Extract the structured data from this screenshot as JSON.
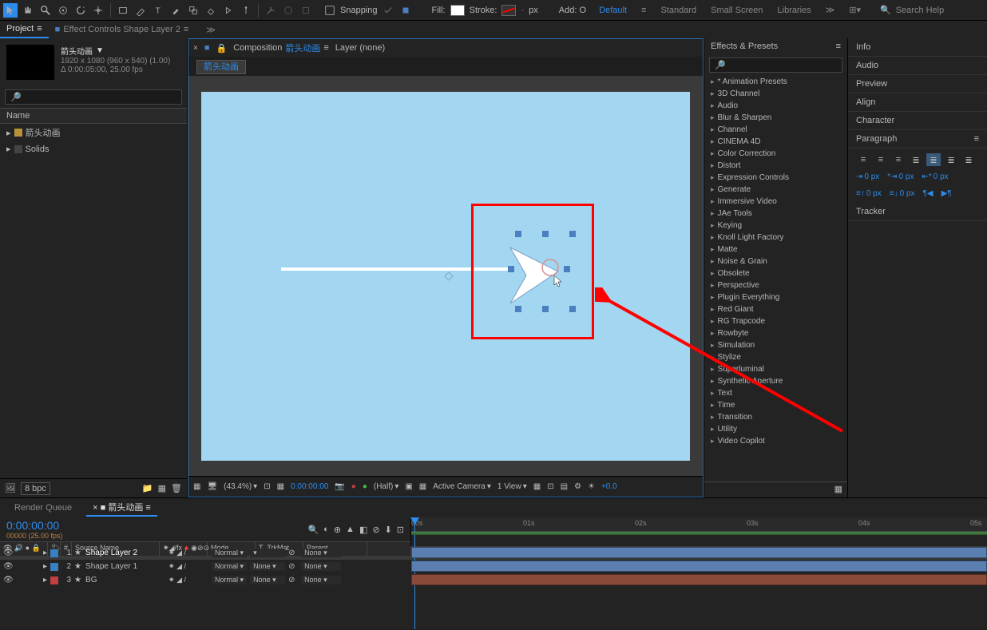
{
  "toolbar": {
    "snapping_label": "Snapping",
    "fill_label": "Fill:",
    "stroke_label": "Stroke:",
    "stroke_px": "px",
    "add_label": "Add: O"
  },
  "workspaces": {
    "default": "Default",
    "standard": "Standard",
    "small_screen": "Small Screen",
    "libraries": "Libraries"
  },
  "search": {
    "placeholder": "Search Help"
  },
  "project": {
    "tab_project": "Project",
    "tab_effect_controls": "Effect Controls Shape Layer 2",
    "comp_name": "箭头动画",
    "comp_dims": "1920 x 1080  (960 x 540) (1.00)",
    "comp_dur": "Δ 0:00:05:00, 25.00 fps",
    "col_name": "Name",
    "items": [
      {
        "name": "箭头动画",
        "color": "#b8923a"
      },
      {
        "name": "Solids",
        "color": "#444444"
      }
    ],
    "bpc": "8 bpc"
  },
  "comp_panel": {
    "tab_comp_prefix": "Composition",
    "tab_comp_name": "箭头动画",
    "tab_layer": "Layer (none)",
    "breadcrumb": "箭头动画",
    "lock_icon": "lock-icon"
  },
  "viewer_footer": {
    "zoom": "(43.4%)",
    "timecode": "0:00:00:00",
    "quality": "(Half)",
    "camera": "Active Camera",
    "view": "1 View",
    "exposure": "+0.0"
  },
  "effects": {
    "title": "Effects & Presets",
    "categories": [
      "* Animation Presets",
      "3D Channel",
      "Audio",
      "Blur & Sharpen",
      "Channel",
      "CINEMA 4D",
      "Color Correction",
      "Distort",
      "Expression Controls",
      "Generate",
      "Immersive Video",
      "JAe Tools",
      "Keying",
      "Knoll Light Factory",
      "Matte",
      "Noise & Grain",
      "Obsolete",
      "Perspective",
      "Plugin Everything",
      "Red Giant",
      "RG Trapcode",
      "Rowbyte",
      "Simulation",
      "Stylize",
      "Superluminal",
      "Synthetic Aperture",
      "Text",
      "Time",
      "Transition",
      "Utility",
      "Video Copilot"
    ]
  },
  "right_panels": {
    "sections": [
      "Info",
      "Audio",
      "Preview",
      "Align",
      "Character"
    ],
    "paragraph": "Paragraph",
    "tracker": "Tracker",
    "indent_val": "0 px"
  },
  "timeline": {
    "tab_render": "Render Queue",
    "tab_comp": "箭头动画",
    "timecode": "0:00:00:00",
    "framerate": "00000 (25.00 fps)",
    "cols": {
      "num": "#",
      "source": "Source Name",
      "mode": "Mode",
      "trkmat": "T .TrkMat",
      "parent": "Parent"
    },
    "ruler": [
      "00s",
      "01s",
      "02s",
      "03s",
      "04s",
      "05s"
    ],
    "layers": [
      {
        "num": "1",
        "name": "Shape Layer 2",
        "color": "#3a7fc0",
        "mode": "Normal",
        "trkmat": "",
        "parent": "None",
        "bar_color": "#5a7fb0",
        "selected": true
      },
      {
        "num": "2",
        "name": "Shape Layer 1",
        "color": "#3a7fc0",
        "mode": "Normal",
        "trkmat": "None",
        "parent": "None",
        "bar_color": "#5a7fb0"
      },
      {
        "num": "3",
        "name": "BG",
        "color": "#c04040",
        "mode": "Normal",
        "trkmat": "None",
        "parent": "None",
        "bar_color": "#8a4a3a"
      }
    ]
  }
}
